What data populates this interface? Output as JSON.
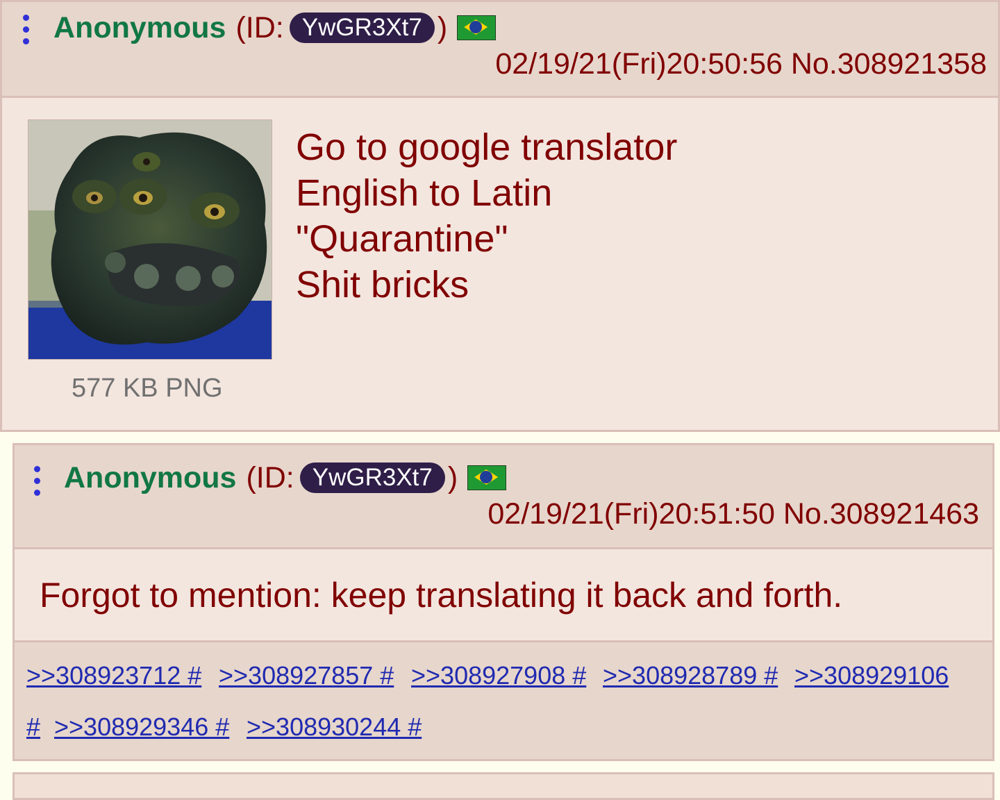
{
  "posts": [
    {
      "name": "Anonymous",
      "id_prefix": "(ID:",
      "id": "YwGR3Xt7",
      "id_suffix": ")",
      "flag": "brazil-flag",
      "datetime": "02/19/21(Fri)20:50:56 No.308921358",
      "file_info": "577 KB PNG",
      "lines": [
        "Go to google translator",
        "English to Latin",
        "\"Quarantine\"",
        "Shit bricks"
      ]
    },
    {
      "name": "Anonymous",
      "id_prefix": "(ID:",
      "id": "YwGR3Xt7",
      "id_suffix": ")",
      "flag": "brazil-flag",
      "datetime": "02/19/21(Fri)20:51:50 No.308921463",
      "text": "Forgot to mention: keep translating it back and forth.",
      "replies": [
        ">>308923712 #",
        ">>308927857 #",
        ">>308927908 #",
        ">>308928789 #",
        ">>308929106",
        "#",
        ">>308929346 #",
        ">>308930244 #"
      ]
    }
  ],
  "colors": {
    "name": "#117743",
    "text": "#800000",
    "link": "#1f2ab0",
    "id_pill": "#2f1e48",
    "post_bg": "#f3e6df",
    "header_bg": "#e7d6cc",
    "page_bg": "#fefeee"
  }
}
